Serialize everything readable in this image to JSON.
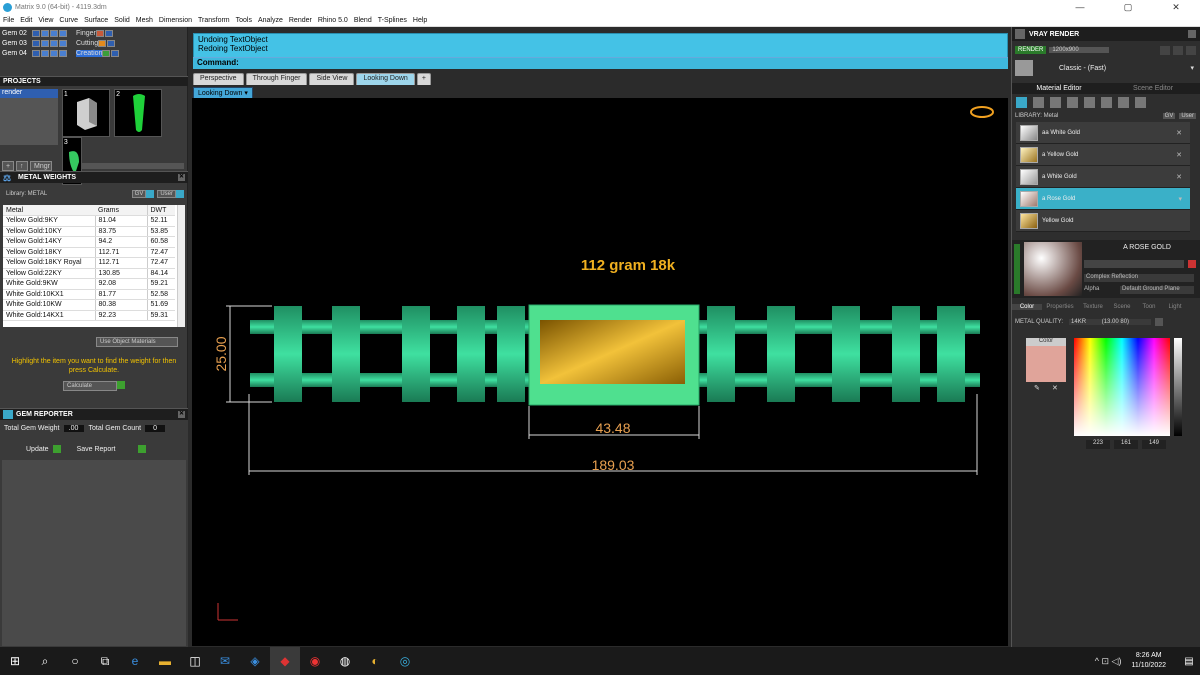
{
  "window": {
    "title": "Matrix 9.0 (64-bit) - 4119.3dm",
    "controls": [
      "—",
      "▢",
      "✕"
    ]
  },
  "menu": [
    "File",
    "Edit",
    "View",
    "Curve",
    "Surface",
    "Solid",
    "Mesh",
    "Dimension",
    "Transform",
    "Tools",
    "Analyze",
    "Render",
    "Rhino 5.0",
    "Blend",
    "T-Splines",
    "Help"
  ],
  "layers": {
    "rows": [
      {
        "name": "Gem 02",
        "tag": "Finger"
      },
      {
        "name": "Gem 03",
        "tag": "Cutting"
      },
      {
        "name": "Gem 04",
        "tag": "Creation"
      }
    ]
  },
  "projects": {
    "title": "PROJECTS",
    "item": "render",
    "thumb_numbers": [
      "1",
      "2",
      "3"
    ],
    "new_label": "Mngr"
  },
  "metal_weights": {
    "title": "METAL WEIGHTS",
    "library_label": "Library: METAL",
    "lib_btns": [
      "GV",
      "User"
    ],
    "headers": [
      "Metal",
      "Grams",
      "DWT"
    ],
    "rows": [
      [
        "Yellow Gold:9KY",
        "81.04",
        "52.11"
      ],
      [
        "Yellow Gold:10KY",
        "83.75",
        "53.85"
      ],
      [
        "Yellow Gold:14KY",
        "94.2",
        "60.58"
      ],
      [
        "Yellow Gold:18KY",
        "112.71",
        "72.47"
      ],
      [
        "Yellow Gold:18KY Royal",
        "112.71",
        "72.47"
      ],
      [
        "Yellow Gold:22KY",
        "130.85",
        "84.14"
      ],
      [
        "White Gold:9KW",
        "92.08",
        "59.21"
      ],
      [
        "White Gold:10KX1",
        "81.77",
        "52.58"
      ],
      [
        "White Gold:10KW",
        "80.38",
        "51.69"
      ],
      [
        "White Gold:14KX1",
        "92.23",
        "59.31"
      ]
    ],
    "use_object": "Use Object Materials",
    "hint": "Highlight the item you want to find the weight for then press Calculate.",
    "calculate": "Calculate"
  },
  "gem_reporter": {
    "title": "GEM REPORTER",
    "total_weight": "Total Gem Weight",
    "total_weight_val": ".00",
    "total_count": "Total Gem Count",
    "total_count_val": "0",
    "update": "Update",
    "save": "Save Report"
  },
  "command": {
    "line1": "Undoing TextObject",
    "line2": "Redoing TextObject",
    "prompt": "Command:"
  },
  "tabs": [
    "Perspective",
    "Through Finger",
    "Side View",
    "Looking Down"
  ],
  "viewport_label": "Looking Down",
  "drawing": {
    "caption": "112 gram 18k",
    "dim_height": "25.00",
    "dim_center": "43.48",
    "dim_total": "189.03"
  },
  "vray": {
    "title": "VRAY RENDER",
    "render": "RENDER",
    "resolution": "1200x900",
    "preset": "Classic - (Fast)"
  },
  "mat_editor": {
    "tabs": [
      "Material Editor",
      "Scene Editor"
    ],
    "library": "LIBRARY: Metal",
    "lib_btns": [
      "GV",
      "User"
    ],
    "items": [
      {
        "name": "aa White Gold",
        "color": "#d8d8d8"
      },
      {
        "name": "a Yellow Gold",
        "color": "#d9b55a"
      },
      {
        "name": "a White Gold",
        "color": "#e6e6e6"
      },
      {
        "name": "a Rose Gold",
        "color": "#c9988a"
      },
      {
        "name": "Yellow Gold",
        "color": "#c9a040"
      }
    ],
    "selected": "A ROSE GOLD",
    "complex": "Complex Reflection",
    "alpha": "Alpha",
    "ground": "Default Ground Plane",
    "subtabs": [
      "Color",
      "Properties",
      "Texture",
      "Scene",
      "Toon",
      "Light"
    ],
    "metal_quality_label": "METAL QUALITY:",
    "metal_quality": "14KR",
    "metal_quality_val": "(13.00 80)",
    "color_label": "Color",
    "swatch": "#e0a49a",
    "rgb": [
      "223",
      "161",
      "149"
    ]
  },
  "taskbar": {
    "time": "8:26 AM",
    "date": "11/10/2022"
  }
}
